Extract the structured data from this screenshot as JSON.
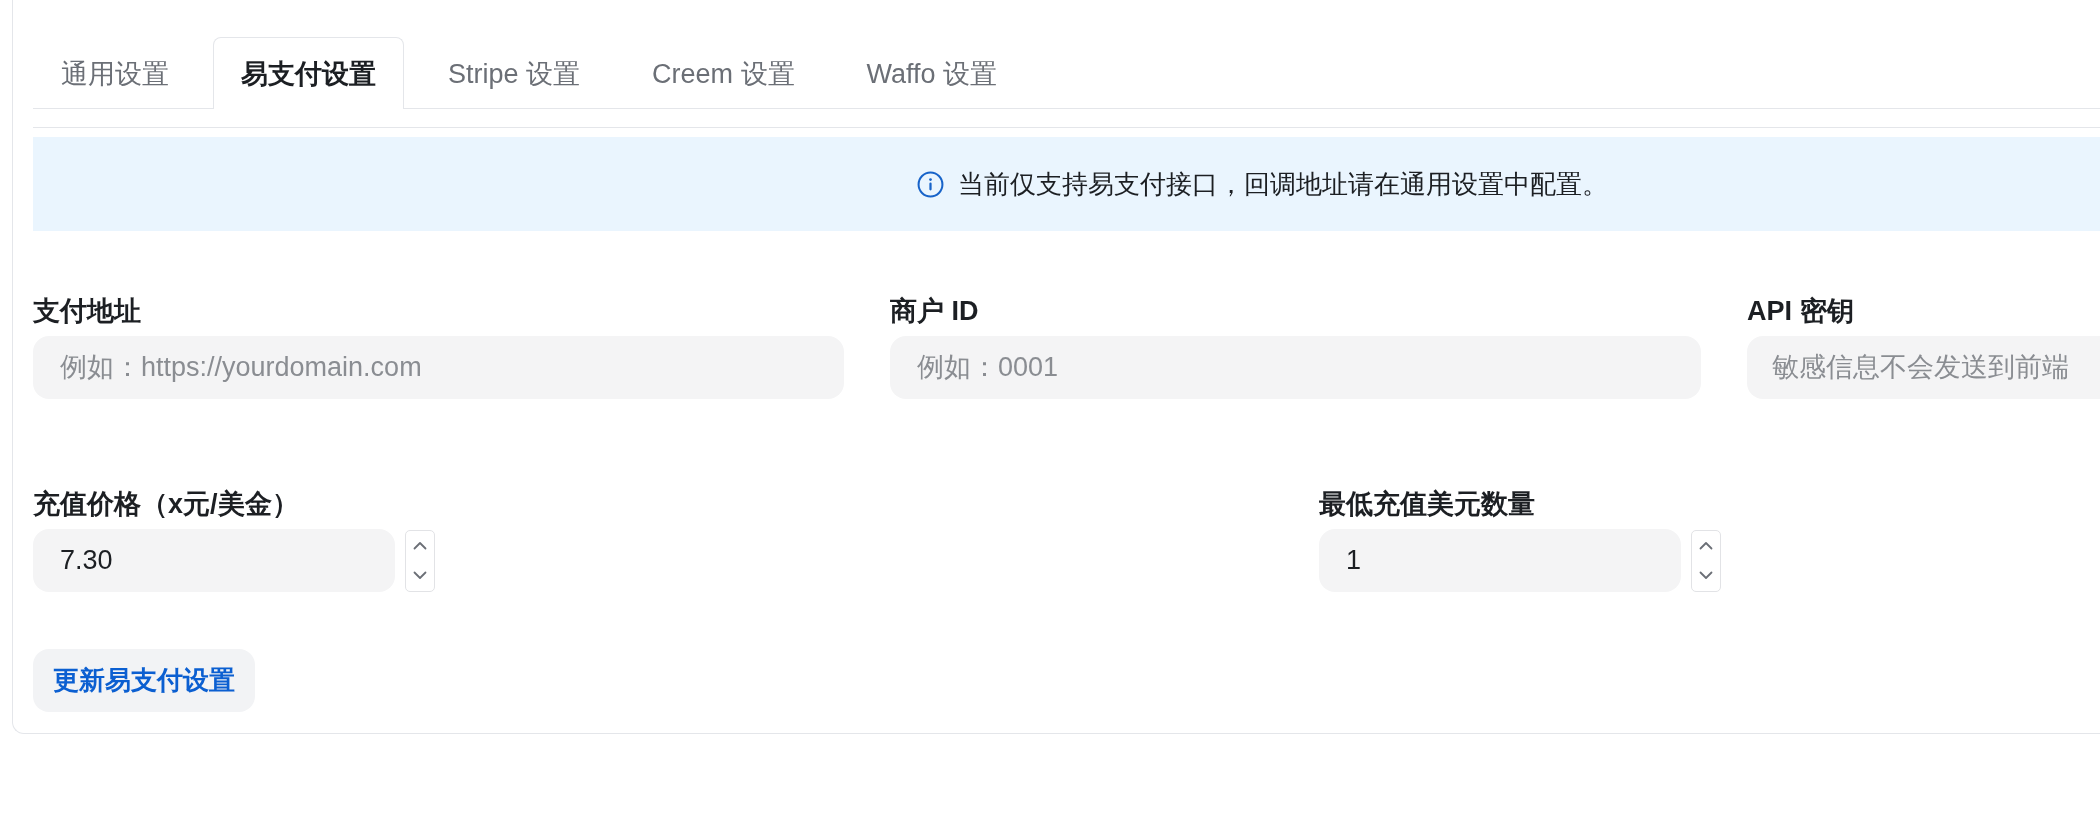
{
  "tabs": [
    {
      "label": "通用设置",
      "selected": false
    },
    {
      "label": "易支付设置",
      "selected": true
    },
    {
      "label": "Stripe 设置",
      "selected": false
    },
    {
      "label": "Creem 设置",
      "selected": false
    },
    {
      "label": "Waffo 设置",
      "selected": false
    }
  ],
  "notice": {
    "text": "当前仅支持易支付接口，回调地址请在通用设置中配置。"
  },
  "fields": [
    {
      "label": "支付地址",
      "placeholder": "例如：https://yourdomain.com"
    },
    {
      "label": "商户 ID",
      "placeholder": "例如：0001"
    },
    {
      "label": "API 密钥",
      "placeholder": "敏感信息不会发送到前端"
    }
  ],
  "number_fields": [
    {
      "label": "充值价格（x元/美金）",
      "value": "7.30"
    },
    {
      "label": "最低充值美元数量",
      "value": "1"
    }
  ],
  "submit_button": {
    "label": "更新易支付设置"
  }
}
